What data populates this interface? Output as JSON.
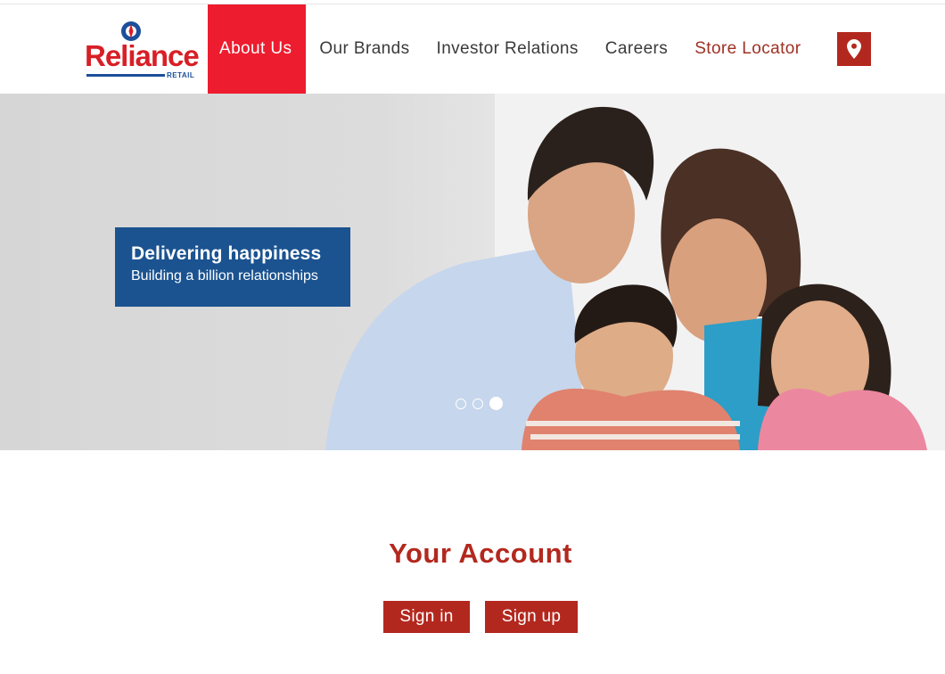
{
  "brand": {
    "logo_text": "Reliance",
    "logo_subtext": "RETAIL",
    "logo_red": "#d81f26",
    "logo_blue": "#1c4f9c"
  },
  "nav": {
    "items": [
      {
        "label": "About Us",
        "active": true
      },
      {
        "label": "Our Brands",
        "active": false
      },
      {
        "label": "Investor Relations",
        "active": false
      },
      {
        "label": "Careers",
        "active": false
      },
      {
        "label": "Store Locator",
        "active": false
      }
    ],
    "store_locator_icon": "map-pin-icon",
    "active_color": "#ed1c2e",
    "accent_color": "#b3281e"
  },
  "hero": {
    "title": "Delivering happiness",
    "subtitle": "Building a billion relationships",
    "caption_color": "#1b5390",
    "slides_total": 3,
    "active_slide": 3
  },
  "account": {
    "title": "Your Account",
    "signin_label": "Sign in",
    "signup_label": "Sign up"
  }
}
